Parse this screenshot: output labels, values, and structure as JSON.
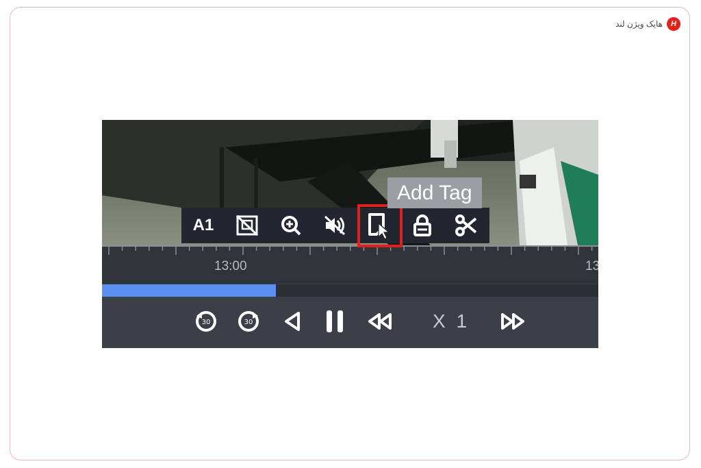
{
  "logo": {
    "text": "هایک ویژن لند",
    "badge": "H"
  },
  "toolbar": {
    "channel_label": "A1",
    "items": [
      {
        "name": "channel",
        "label": "A1"
      },
      {
        "name": "snapshot-off",
        "icon": "image-crossed-icon"
      },
      {
        "name": "digital-zoom",
        "icon": "zoom-in-icon"
      },
      {
        "name": "audio-off",
        "icon": "speaker-muted-icon"
      },
      {
        "name": "add-tag",
        "icon": "tag-icon"
      },
      {
        "name": "lock",
        "icon": "lock-icon"
      },
      {
        "name": "clip",
        "icon": "scissors-icon"
      }
    ],
    "tooltip": "Add Tag",
    "highlight_color": "#e0201c"
  },
  "timeline": {
    "time_labels": [
      "13:00",
      "13"
    ],
    "progress_fraction": 0.35
  },
  "controls": {
    "speed_label": "X 1",
    "buttons": [
      {
        "name": "rewind-30s",
        "icon": "replay-30-icon"
      },
      {
        "name": "forward-30s",
        "icon": "forward-30-icon"
      },
      {
        "name": "reverse-play",
        "icon": "play-reverse-icon"
      },
      {
        "name": "pause",
        "icon": "pause-icon"
      },
      {
        "name": "slow-down",
        "icon": "fast-rewind-icon"
      },
      {
        "name": "speed-up",
        "icon": "fast-forward-icon"
      }
    ]
  },
  "colors": {
    "progress": "#5a8fef",
    "toolbar_bg": "#222630",
    "controls_bg": "#3b4048",
    "brand": "#e2231a"
  }
}
